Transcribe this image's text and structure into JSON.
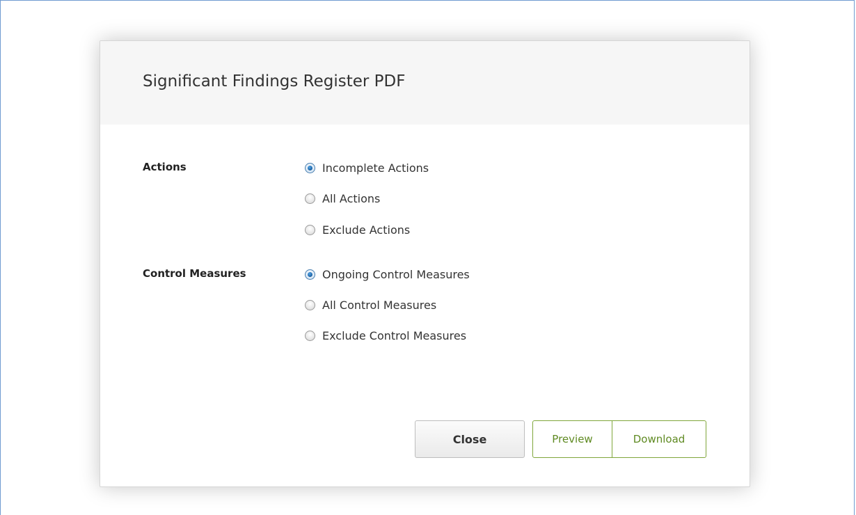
{
  "dialog": {
    "title": "Significant Findings Register PDF"
  },
  "actions": {
    "label": "Actions",
    "options": [
      {
        "label": "Incomplete Actions",
        "checked": true
      },
      {
        "label": "All Actions",
        "checked": false
      },
      {
        "label": "Exclude Actions",
        "checked": false
      }
    ]
  },
  "control_measures": {
    "label": "Control Measures",
    "options": [
      {
        "label": "Ongoing Control Measures",
        "checked": true
      },
      {
        "label": "All Control Measures",
        "checked": false
      },
      {
        "label": "Exclude Control Measures",
        "checked": false
      }
    ]
  },
  "buttons": {
    "close": "Close",
    "preview": "Preview",
    "download": "Download"
  },
  "colors": {
    "accent_green": "#7fa63a",
    "frame_blue": "#6f9ad0",
    "radio_selected": "#1b5f9f"
  }
}
